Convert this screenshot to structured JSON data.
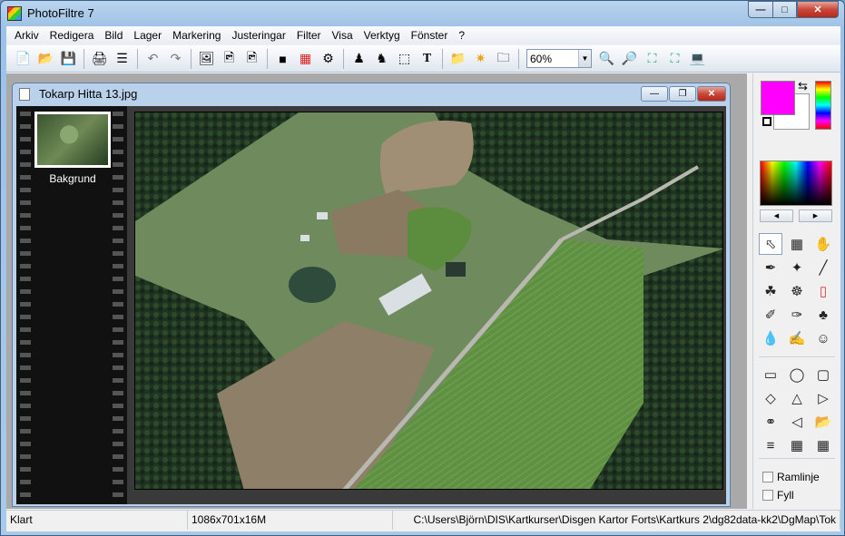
{
  "window": {
    "title": "PhotoFiltre 7",
    "min_label": "—",
    "max_label": "□",
    "close_label": "✕"
  },
  "menubar": [
    "Arkiv",
    "Redigera",
    "Bild",
    "Lager",
    "Markering",
    "Justeringar",
    "Filter",
    "Visa",
    "Verktyg",
    "Fönster",
    "?"
  ],
  "toolbar": {
    "zoom_value": "60%"
  },
  "document": {
    "title": "Tokarp Hitta 13.jpg",
    "layer_label": "Bakgrund"
  },
  "options": {
    "outline_label": "Ramlinje",
    "fill_label": "Fyll"
  },
  "colors": {
    "foreground": "#ff00ff",
    "background": "#ffffff"
  },
  "status": {
    "state": "Klart",
    "image_size": "1086x701x16M",
    "file_path": "C:\\Users\\Björn\\DIS\\Kartkurser\\Disgen Kartor Forts\\Kartkurs 2\\dg82data-kk2\\DgMap\\Tok"
  }
}
